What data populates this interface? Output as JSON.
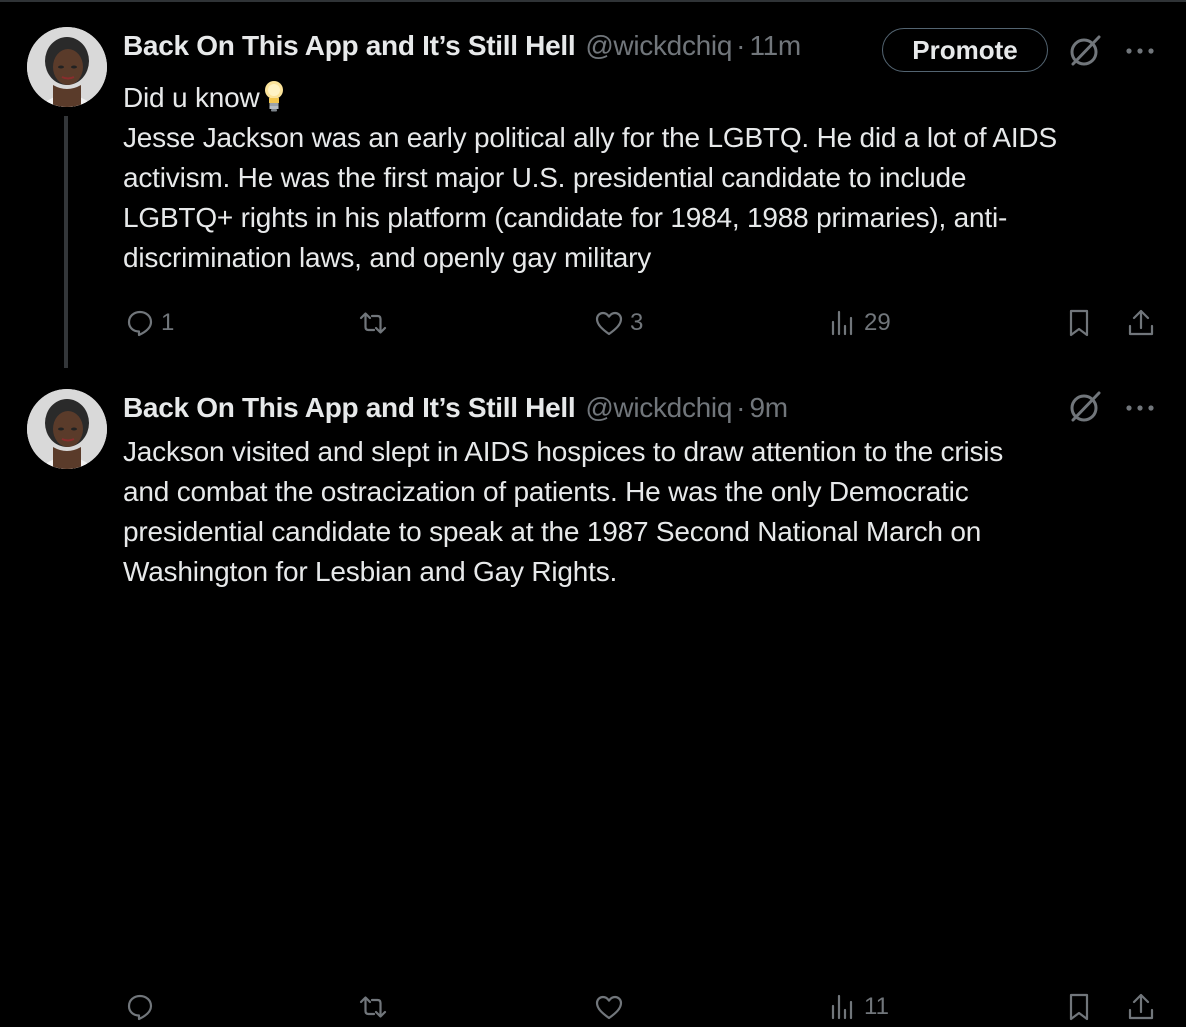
{
  "colors": {
    "background": "#000000",
    "text": "#e7e9ea",
    "secondary": "#71767b",
    "divider": "#2f3336"
  },
  "tweets": [
    {
      "author": {
        "display_name": "Back On This App and It’s Still Hell",
        "handle": "@wickdchiq"
      },
      "separator": "·",
      "time": "11m",
      "promote_label": "Promote",
      "body_lines": [
        "Did u know",
        "Jesse Jackson was an early political ally for the LGBTQ. He did a lot of AIDS",
        "activism. He was the first major U.S. presidential candidate to include",
        "LGBTQ+ rights in his platform (candidate for 1984, 1988 primaries), anti-",
        "discrimination laws, and openly gay military"
      ],
      "counts": {
        "replies": "1",
        "reposts": "",
        "likes": "3",
        "views": "29"
      },
      "icons": [
        "reply-icon",
        "repost-icon",
        "like-icon",
        "views-icon",
        "bookmark-icon",
        "share-icon",
        "grok-icon",
        "more-icon",
        "lightbulb-emoji"
      ]
    },
    {
      "author": {
        "display_name": "Back On This App and It’s Still Hell",
        "handle": "@wickdchiq"
      },
      "separator": "·",
      "time": "9m",
      "body_lines": [
        "Jackson visited and slept in AIDS hospices to draw attention to the crisis",
        "and combat the ostracization of patients. He was the only Democratic",
        "presidential candidate to speak at the 1987 Second National March on",
        "Washington for Lesbian and Gay Rights."
      ],
      "counts": {
        "replies": "",
        "reposts": "",
        "likes": "",
        "views": "11"
      },
      "icons": [
        "reply-icon",
        "repost-icon",
        "like-icon",
        "views-icon",
        "bookmark-icon",
        "share-icon",
        "grok-icon",
        "more-icon"
      ]
    }
  ]
}
